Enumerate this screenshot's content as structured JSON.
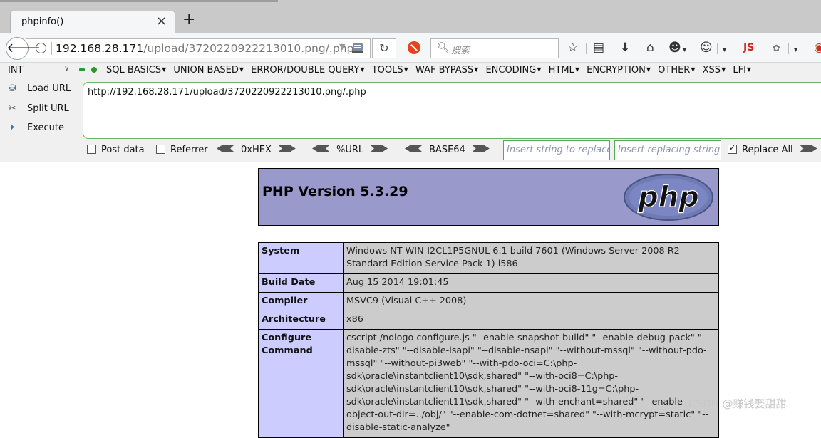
{
  "browser": {
    "tab_title": "phpinfo()",
    "tab_close": "×",
    "new_tab": "+",
    "url_host": "192.168.28.171",
    "url_path": "/upload/3720220922213010.png/.php",
    "search_placeholder": "搜索",
    "js_label": "JS"
  },
  "hackbar": {
    "int_select": "INT",
    "menu": [
      "SQL BASICS",
      "UNION BASED",
      "ERROR/DOUBLE QUERY",
      "TOOLS",
      "WAF BYPASS",
      "ENCODING",
      "HTML",
      "ENCRYPTION",
      "OTHER",
      "XSS",
      "LFI"
    ],
    "load_url": "Load URL",
    "split_url": "Split URL",
    "execute": "Execute",
    "textarea_value": "http://192.168.28.171/upload/3720220922213010.png/.php",
    "post_data": "Post data",
    "referrer": "Referrer",
    "hex": "0xHEX",
    "url_enc": "%URL",
    "base64": "BASE64",
    "replace_placeholder": "Insert string to replace",
    "replacing_placeholder": "Insert replacing string",
    "replace_all": "Replace All",
    "replace_all_checked": true
  },
  "phpinfo": {
    "title": "PHP Version 5.3.29",
    "logo_text": "php",
    "rows": [
      {
        "key": "System",
        "value": "Windows NT WIN-I2CL1P5GNUL 6.1 build 7601 (Windows Server 2008 R2 Standard Edition Service Pack 1) i586"
      },
      {
        "key": "Build Date",
        "value": "Aug 15 2014 19:01:45"
      },
      {
        "key": "Compiler",
        "value": "MSVC9 (Visual C++ 2008)"
      },
      {
        "key": "Architecture",
        "value": "x86"
      },
      {
        "key": "Configure Command",
        "value": "cscript /nologo configure.js \"--enable-snapshot-build\" \"--enable-debug-pack\" \"--disable-zts\" \"--disable-isapi\" \"--disable-nsapi\" \"--without-mssql\" \"--without-pdo-mssql\" \"--without-pi3web\" \"--with-pdo-oci=C:\\php-sdk\\oracle\\instantclient10\\sdk,shared\" \"--with-oci8=C:\\php-sdk\\oracle\\instantclient10\\sdk,shared\" \"--with-oci8-11g=C:\\php-sdk\\oracle\\instantclient11\\sdk,shared\" \"--with-enchant=shared\" \"--enable-object-out-dir=../obj/\" \"--enable-com-dotnet=shared\" \"--with-mcrypt=static\" \"--disable-static-analyze\""
      }
    ]
  },
  "watermark": "CSDN @赚钱娶甜甜",
  "colors": {
    "php_header": "#9999cc",
    "php_key": "#ccccff",
    "php_value": "#cccccc",
    "hackbar_border": "#58a858"
  }
}
